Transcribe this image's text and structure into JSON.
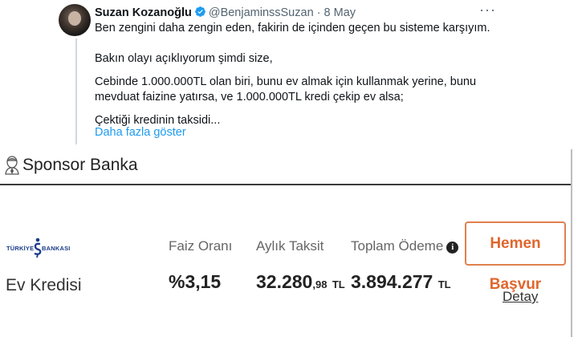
{
  "tweet": {
    "name": "Suzan Kozanoğlu",
    "handle": "@BenjaminssSuzan",
    "separator": "·",
    "date": "8 May",
    "more_icon": "more-icon",
    "lines": [
      "Ben zengini daha zengin eden, fakirin de içinden geçen bu sisteme karşıyım.",
      "Bakın olayı açıklıyorum şimdi size,",
      "Cebinde 1.000.000TL olan biri, bunu ev almak için kullanmak yerine, bunu",
      "mevduat faizine yatırsa, ve 1.000.000TL kredi çekip ev alsa;",
      "Çektiği kredinin taksidi..."
    ],
    "show_more": "Daha fazla göster",
    "link_color": "#1d9bf0"
  },
  "sponsor": {
    "title": "Sponsor Banka",
    "bank_logo_left": "TÜRKİYE",
    "bank_logo_right": "BANKASI",
    "product": "Ev Kredisi",
    "labels": {
      "rate": "Faiz Oranı",
      "installment": "Aylık Taksit",
      "total": "Toplam Ödeme"
    },
    "values": {
      "rate": "%3,15",
      "installment_main": "32.280",
      "installment_fraction": ",98",
      "installment_unit": "TL",
      "total_main": "3.894.277",
      "total_unit": "TL"
    },
    "info_glyph": "i",
    "apply_button": "Hemen Başvur",
    "detail_link": "Detay",
    "accent_color": "#e0662d"
  }
}
